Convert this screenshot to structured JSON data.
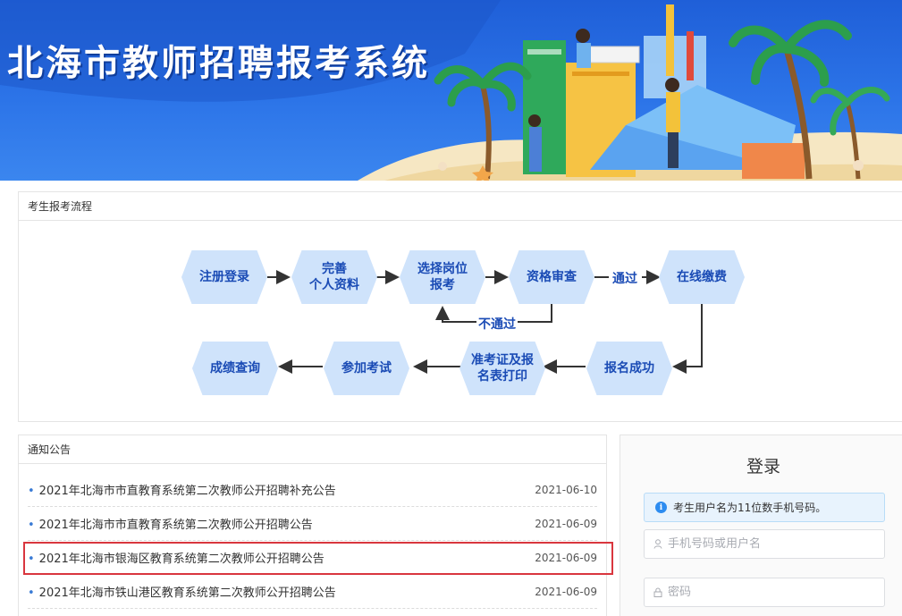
{
  "banner": {
    "title": "北海市教师招聘报考系统"
  },
  "process": {
    "header": "考生报考流程",
    "steps": {
      "register": "注册登录",
      "profile_l1": "完善",
      "profile_l2": "个人资料",
      "select_l1": "选择岗位",
      "select_l2": "报考",
      "review": "资格审查",
      "pay": "在线缴费",
      "success": "报名成功",
      "ticket_l1": "准考证及报",
      "ticket_l2": "名表打印",
      "exam": "参加考试",
      "score": "成绩查询"
    },
    "labels": {
      "pass": "通过",
      "fail": "不通过"
    }
  },
  "notices": {
    "header": "通知公告",
    "items": [
      {
        "title": "2021年北海市市直教育系统第二次教师公开招聘补充公告",
        "date": "2021-06-10"
      },
      {
        "title": "2021年北海市市直教育系统第二次教师公开招聘公告",
        "date": "2021-06-09"
      },
      {
        "title": "2021年北海市银海区教育系统第二次教师公开招聘公告",
        "date": "2021-06-09"
      },
      {
        "title": "2021年北海市铁山港区教育系统第二次教师公开招聘公告",
        "date": "2021-06-09"
      }
    ]
  },
  "login": {
    "title": "登录",
    "tip": "考生用户名为11位数手机号码。",
    "username_placeholder": "手机号码或用户名",
    "password_placeholder": "密码"
  },
  "colors": {
    "accent": "#1a4bb5",
    "step_bg": "#cfe3fb",
    "highlight": "#d9363e",
    "banner": "#2c74e8"
  }
}
